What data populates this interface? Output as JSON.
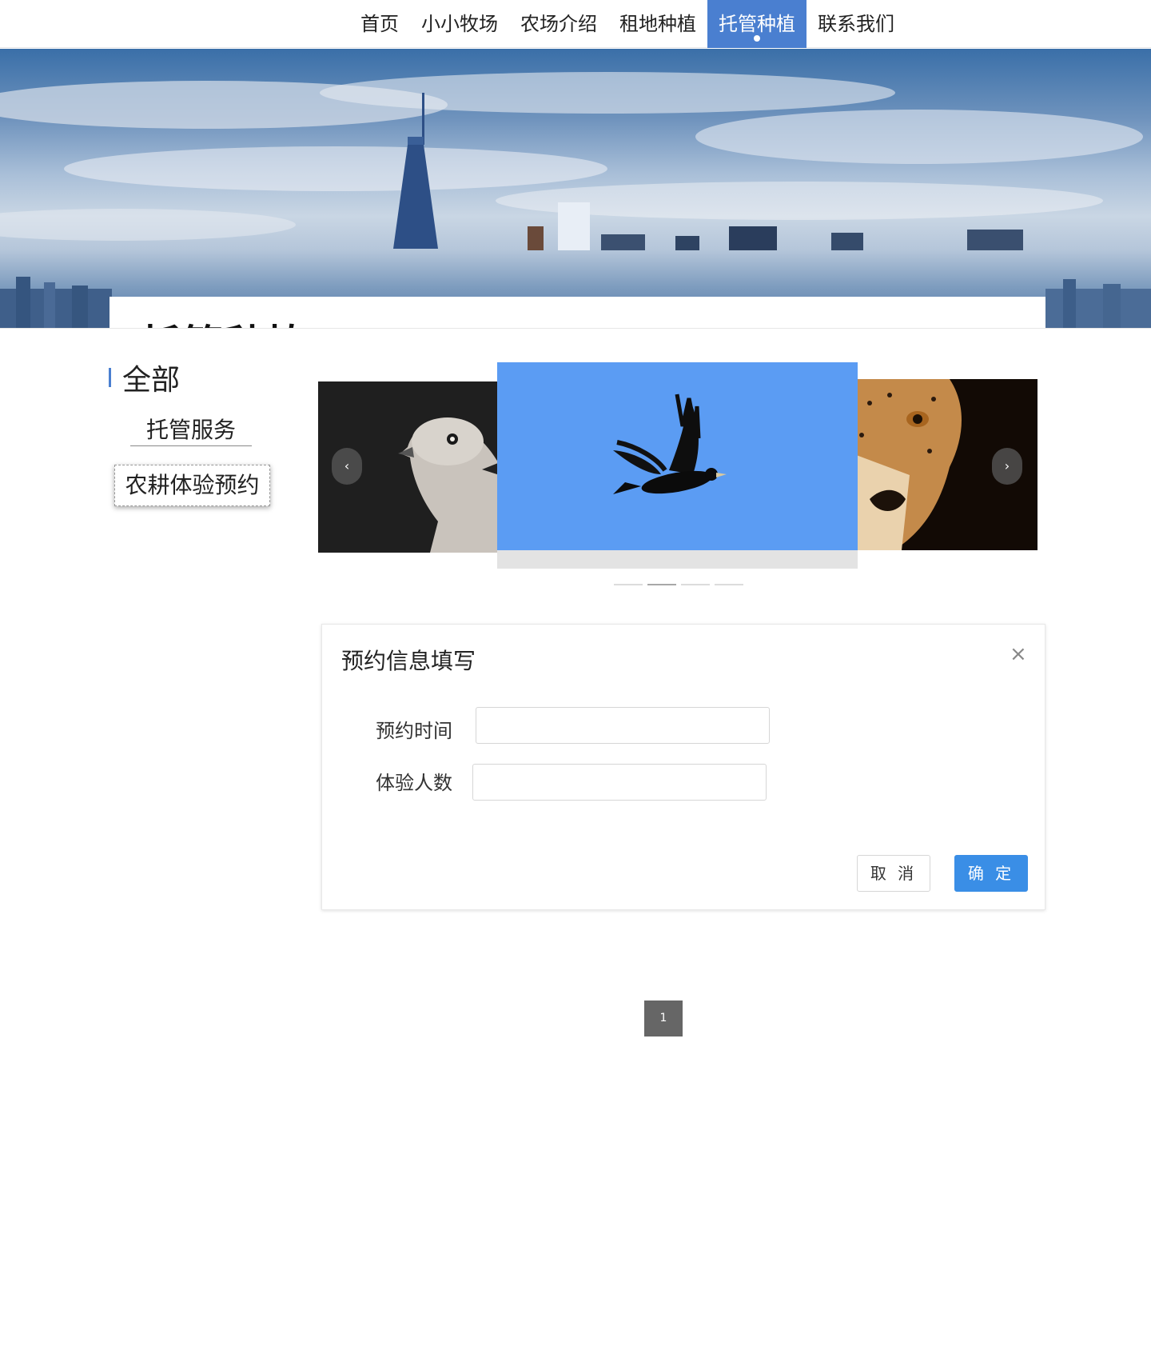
{
  "nav": {
    "items": [
      {
        "label": "首页"
      },
      {
        "label": "小小牧场"
      },
      {
        "label": "农场介绍"
      },
      {
        "label": "租地种植"
      },
      {
        "label": "托管种植"
      },
      {
        "label": "联系我们"
      }
    ],
    "active_index": 4
  },
  "hero": {
    "title": "托管种植"
  },
  "sidebar": {
    "heading": "全部",
    "items": [
      {
        "label": "托管服务"
      },
      {
        "label": "农耕体验预约"
      }
    ]
  },
  "carousel": {
    "prev_icon": "chevron-left-icon",
    "next_icon": "chevron-right-icon",
    "prev_glyph": "‹",
    "next_glyph": "›",
    "slides": [
      {
        "subject": "dove"
      },
      {
        "subject": "crow"
      },
      {
        "subject": "cheetah"
      }
    ],
    "indicator_count": 4,
    "active_indicator": 1
  },
  "dialog": {
    "title": "预约信息填写",
    "close_glyph": "×",
    "fields": [
      {
        "label": "预约时间",
        "value": "",
        "placeholder": ""
      },
      {
        "label": "体验人数",
        "value": "",
        "placeholder": ""
      }
    ],
    "cancel_label": "取 消",
    "ok_label": "确 定"
  },
  "pagination": {
    "current": "1"
  },
  "colors": {
    "accent": "#4a7fd0",
    "primary_button": "#3a8ee6",
    "page_button": "#666666",
    "sky": "#5b9cf3"
  }
}
